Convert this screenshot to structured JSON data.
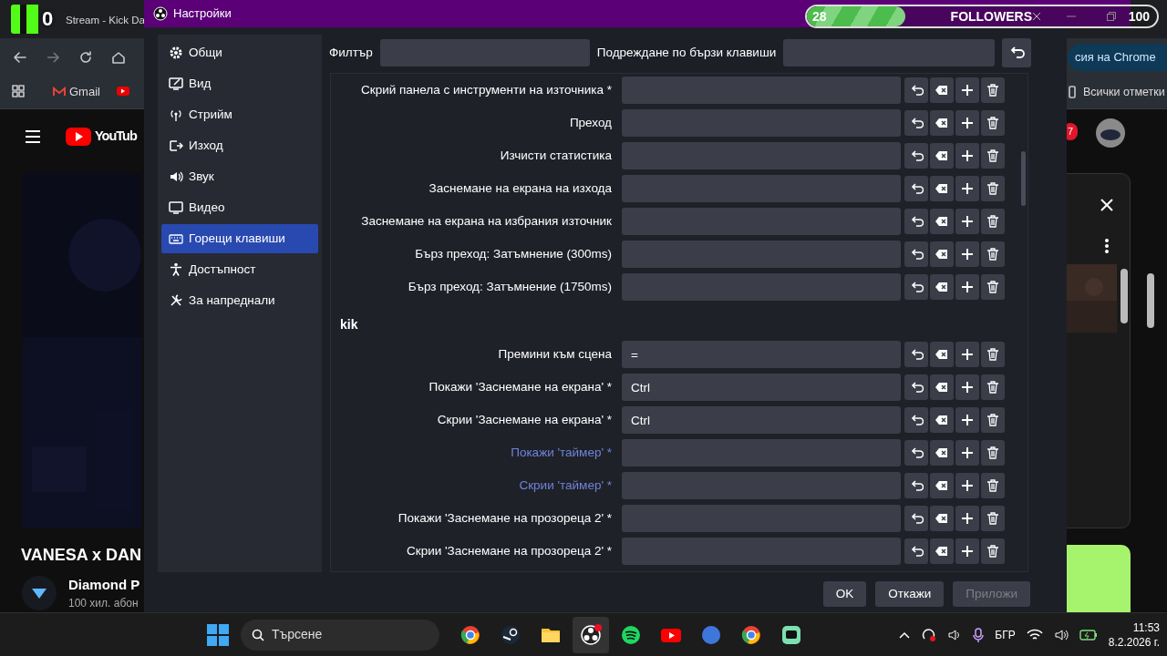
{
  "browser": {
    "tab_title": "Stream - Kick Da",
    "bookmark": "Gmail",
    "profile_button": "сия на Chrome",
    "all_bookmarks": "Всички отметки",
    "site_logo": "YouTub",
    "notification_count": "7",
    "video_title": "VANESA x DAN",
    "channel_name": "Diamond P",
    "channel_subscribers": "100 хил. абон"
  },
  "kick_widget": {
    "count": "0"
  },
  "followers_goal": {
    "current": "28",
    "label": "FOLLOWERS",
    "target": "100",
    "level": 0.28
  },
  "window": {
    "title": "Настройки"
  },
  "sidebar": {
    "items": [
      {
        "label": "Общи",
        "selected": false
      },
      {
        "label": "Вид",
        "selected": false
      },
      {
        "label": "Стрийм",
        "selected": false
      },
      {
        "label": "Изход",
        "selected": false
      },
      {
        "label": "Звук",
        "selected": false
      },
      {
        "label": "Видео",
        "selected": false
      },
      {
        "label": "Горещи клавиши",
        "selected": true
      },
      {
        "label": "Достъпност",
        "selected": false
      },
      {
        "label": "За напреднали",
        "selected": false
      }
    ]
  },
  "filter": {
    "label": "Филтър",
    "hotkey_label": "Подреждане по бързи клавиши"
  },
  "sections": [
    {
      "rows": [
        {
          "label": "Скрий панела с инструменти на източника *",
          "highlighted": false
        },
        {
          "label": "Преход",
          "highlighted": false
        },
        {
          "label": "Изчисти статистика",
          "highlighted": false
        },
        {
          "label": "Заснемане на екрана на изхода",
          "highlighted": false
        },
        {
          "label": "Заснемане на екрана на избрания източник",
          "highlighted": false
        },
        {
          "label": "Бърз преход: Затъмнение (300ms)",
          "highlighted": false
        },
        {
          "label": "Бърз преход: Затъмнение (1750ms)",
          "highlighted": false
        }
      ]
    },
    {
      "header": "kik",
      "rows": [
        {
          "label": "Премини към сцена",
          "value": "=",
          "highlighted": false
        },
        {
          "label": "Покажи 'Заснемане на екрана' *",
          "value": "Ctrl",
          "highlighted": false
        },
        {
          "label": "Скрии 'Заснемане на екрана' *",
          "value": "Ctrl",
          "highlighted": false
        },
        {
          "label": "Покажи 'таймер' *",
          "highlighted": true
        },
        {
          "label": "Скрии 'таймер' *",
          "highlighted": true
        },
        {
          "label": "Покажи 'Заснемане на прозореца 2' *",
          "highlighted": false
        },
        {
          "label": "Скрии 'Заснемане на прозореца 2' *",
          "highlighted": false
        }
      ]
    }
  ],
  "buttons": [
    {
      "label": "OK",
      "disabled": false
    },
    {
      "label": "Откажи",
      "disabled": false
    },
    {
      "label": "Приложи",
      "disabled": true
    }
  ],
  "taskbar": {
    "search_placeholder": "Търсене",
    "language": "БГР",
    "time": "11:53",
    "date": "8.2.2026 г."
  }
}
